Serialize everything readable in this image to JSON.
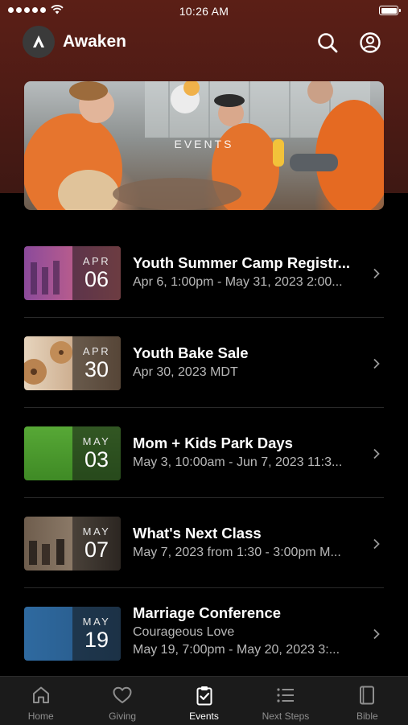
{
  "status_bar": {
    "time": "10:26 AM"
  },
  "header": {
    "title": "Awaken",
    "logo_icon": "awaken-logo-icon",
    "icons": [
      "search-icon",
      "account-icon"
    ]
  },
  "hero": {
    "label": "EVENTS"
  },
  "events": [
    {
      "title": "Youth Summer Camp Registr...",
      "subtitle": "Apr 6, 1:00pm - May 31, 2023 2:00...",
      "month": "APR",
      "day": "06",
      "thumb_color": "#7b3f86"
    },
    {
      "title": "Youth Bake Sale",
      "subtitle": "Apr 30, 2023 MDT",
      "month": "APR",
      "day": "30",
      "thumb_color": "#c9a98a"
    },
    {
      "title": "Mom + Kids Park Days",
      "subtitle": "May 3, 10:00am - Jun 7, 2023 11:3...",
      "month": "MAY",
      "day": "03",
      "thumb_color": "#4a9a2e"
    },
    {
      "title": "What's Next Class",
      "subtitle": "May 7, 2023 from 1:30 - 3:00pm M...",
      "month": "MAY",
      "day": "07",
      "thumb_color": "#5a4a3a"
    },
    {
      "title": "Marriage Conference",
      "subtitle": "Courageous Love",
      "subtitle2": "May 19, 7:00pm - May 20, 2023 3:...",
      "month": "MAY",
      "day": "19",
      "thumb_color": "#2e5d8c"
    }
  ],
  "tabs": [
    {
      "label": "Home",
      "icon": "home-icon",
      "active": false
    },
    {
      "label": "Giving",
      "icon": "heart-icon",
      "active": false
    },
    {
      "label": "Events",
      "icon": "clipboard-check-icon",
      "active": true
    },
    {
      "label": "Next Steps",
      "icon": "list-icon",
      "active": false
    },
    {
      "label": "Bible",
      "icon": "book-icon",
      "active": false
    }
  ]
}
